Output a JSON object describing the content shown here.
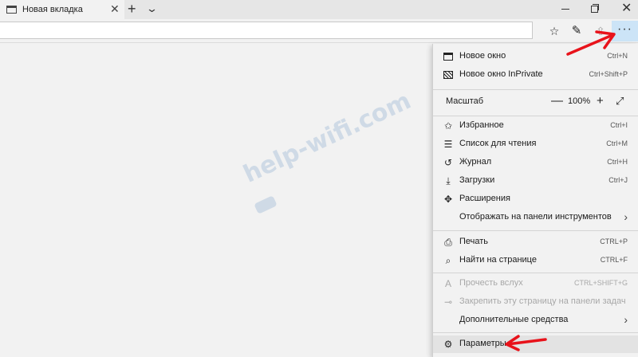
{
  "tab": {
    "title": "Новая вкладка"
  },
  "watermark": {
    "text": "help-wifi.com"
  },
  "toolbar": {
    "more_label": "···"
  },
  "menu": {
    "new_window": {
      "label": "Новое окно",
      "shortcut": "Ctrl+N"
    },
    "new_private": {
      "label": "Новое окно InPrivate",
      "shortcut": "Ctrl+Shift+P"
    },
    "zoom": {
      "label": "Масштаб",
      "value": "100%"
    },
    "favorites": {
      "label": "Избранное",
      "shortcut": "Ctrl+I"
    },
    "reading_list": {
      "label": "Список для чтения",
      "shortcut": "Ctrl+M"
    },
    "history": {
      "label": "Журнал",
      "shortcut": "Ctrl+H"
    },
    "downloads": {
      "label": "Загрузки",
      "shortcut": "Ctrl+J"
    },
    "extensions": {
      "label": "Расширения"
    },
    "show_toolbar": {
      "label": "Отображать на панели инструментов"
    },
    "print": {
      "label": "Печать",
      "shortcut": "CTRL+P"
    },
    "find": {
      "label": "Найти на странице",
      "shortcut": "CTRL+F"
    },
    "read_aloud": {
      "label": "Прочесть вслух",
      "shortcut": "CTRL+SHIFT+G"
    },
    "pin": {
      "label": "Закрепить эту страницу на панели задач"
    },
    "more_tools": {
      "label": "Дополнительные средства"
    },
    "settings": {
      "label": "Параметры"
    }
  },
  "colors": {
    "accent_bg": "#cce4f7",
    "arrow": "#e8131b",
    "watermark": "#cfdae6"
  }
}
